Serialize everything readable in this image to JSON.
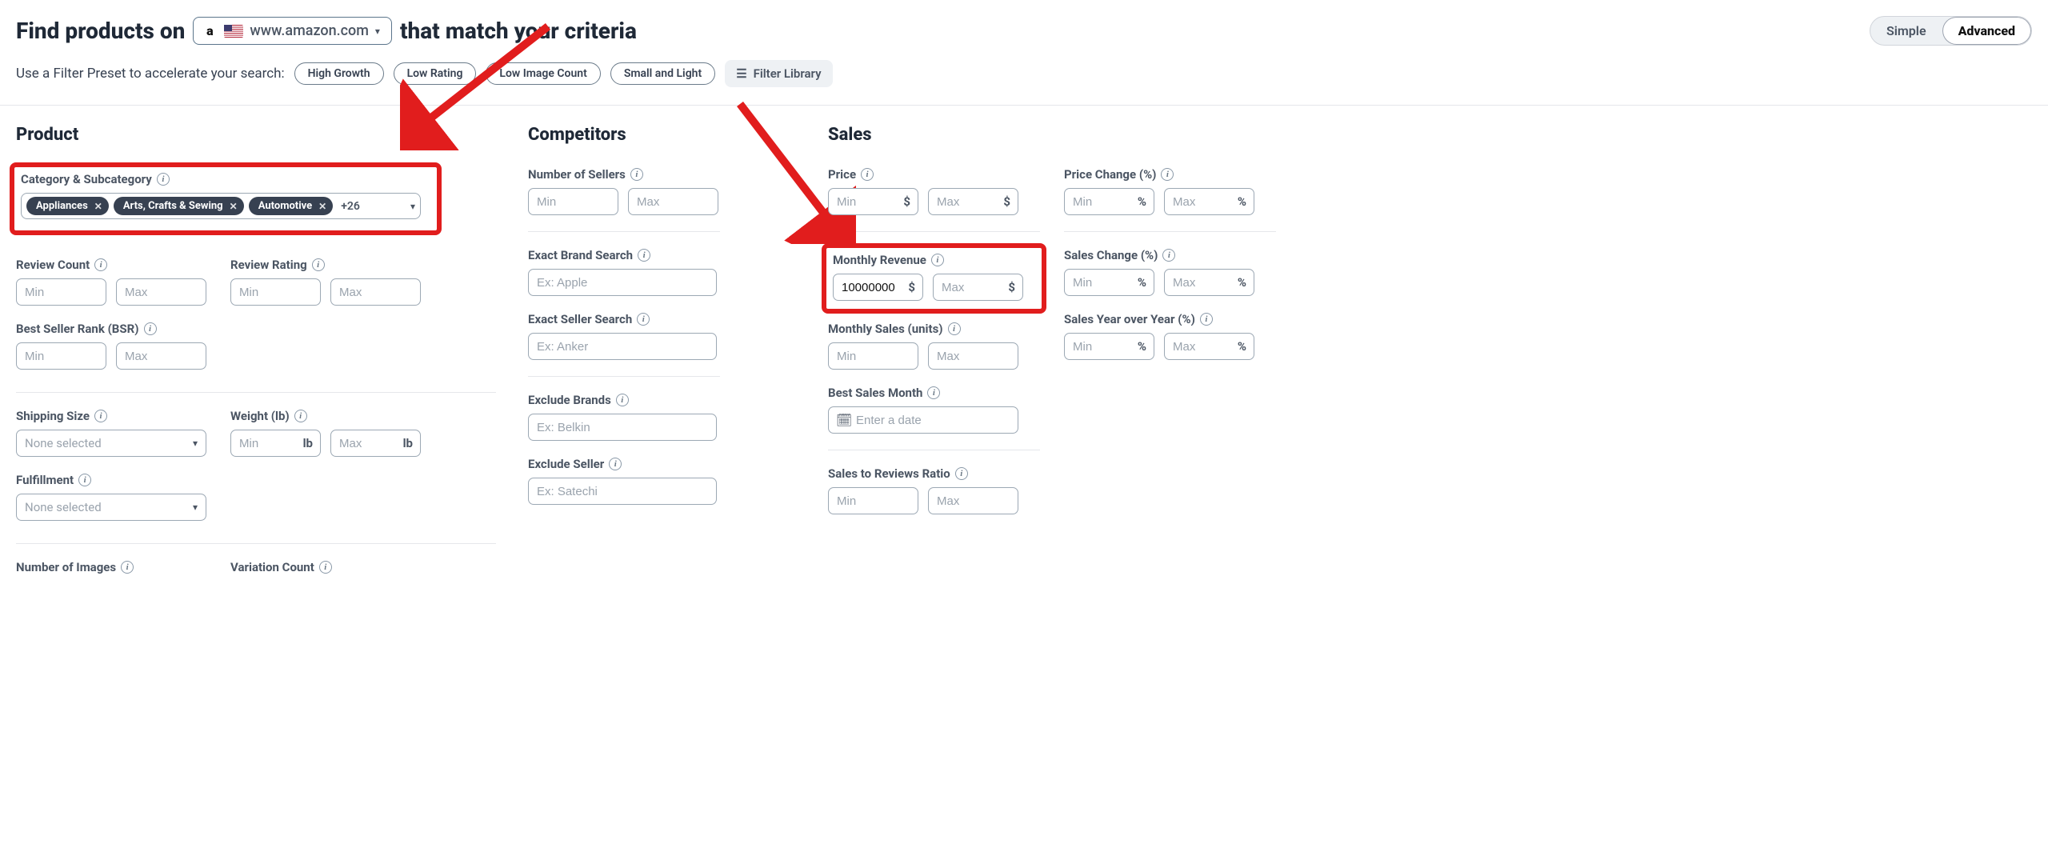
{
  "header": {
    "title_part1": "Find products on",
    "title_part2": "that match your criteria",
    "domain": "www.amazon.com",
    "mode_simple": "Simple",
    "mode_advanced": "Advanced"
  },
  "presets": {
    "label": "Use a Filter Preset to accelerate your search:",
    "items": [
      "High Growth",
      "Low Rating",
      "Low Image Count",
      "Small and Light"
    ],
    "library": "Filter Library"
  },
  "sections": {
    "product": "Product",
    "competitors": "Competitors",
    "sales": "Sales"
  },
  "product": {
    "category": {
      "label": "Category & Subcategory",
      "chips": [
        "Appliances",
        "Arts, Crafts & Sewing",
        "Automotive"
      ],
      "more": "+26"
    },
    "review_count": {
      "label": "Review Count",
      "min_ph": "Min",
      "max_ph": "Max"
    },
    "review_rating": {
      "label": "Review Rating",
      "min_ph": "Min",
      "max_ph": "Max"
    },
    "bsr": {
      "label": "Best Seller Rank (BSR)",
      "min_ph": "Min",
      "max_ph": "Max"
    },
    "shipping": {
      "label": "Shipping Size",
      "placeholder": "None selected"
    },
    "weight": {
      "label": "Weight (lb)",
      "min_ph": "Min",
      "max_ph": "Max",
      "unit": "lb"
    },
    "fulfillment": {
      "label": "Fulfillment",
      "placeholder": "None selected"
    },
    "num_images": {
      "label": "Number of Images"
    },
    "variation": {
      "label": "Variation Count"
    }
  },
  "competitors": {
    "sellers": {
      "label": "Number of Sellers",
      "min_ph": "Min",
      "max_ph": "Max"
    },
    "brand": {
      "label": "Exact Brand Search",
      "ph": "Ex: Apple"
    },
    "seller_search": {
      "label": "Exact Seller Search",
      "ph": "Ex: Anker"
    },
    "excl_brands": {
      "label": "Exclude Brands",
      "ph": "Ex: Belkin"
    },
    "excl_seller": {
      "label": "Exclude Seller",
      "ph": "Ex: Satechi"
    }
  },
  "sales": {
    "price": {
      "label": "Price",
      "min_ph": "Min",
      "max_ph": "Max",
      "unit": "$"
    },
    "price_change": {
      "label": "Price Change (%)",
      "min_ph": "Min",
      "max_ph": "Max",
      "unit": "%"
    },
    "revenue": {
      "label": "Monthly Revenue",
      "min_value": "10000000",
      "max_ph": "Max",
      "unit": "$"
    },
    "sales_change": {
      "label": "Sales Change (%)",
      "min_ph": "Min",
      "max_ph": "Max",
      "unit": "%"
    },
    "units": {
      "label": "Monthly Sales (units)",
      "min_ph": "Min",
      "max_ph": "Max"
    },
    "yoy": {
      "label": "Sales Year over Year (%)",
      "min_ph": "Min",
      "max_ph": "Max",
      "unit": "%"
    },
    "best_month": {
      "label": "Best Sales Month",
      "ph": "Enter a date"
    },
    "ratio": {
      "label": "Sales to Reviews Ratio",
      "min_ph": "Min",
      "max_ph": "Max"
    }
  }
}
